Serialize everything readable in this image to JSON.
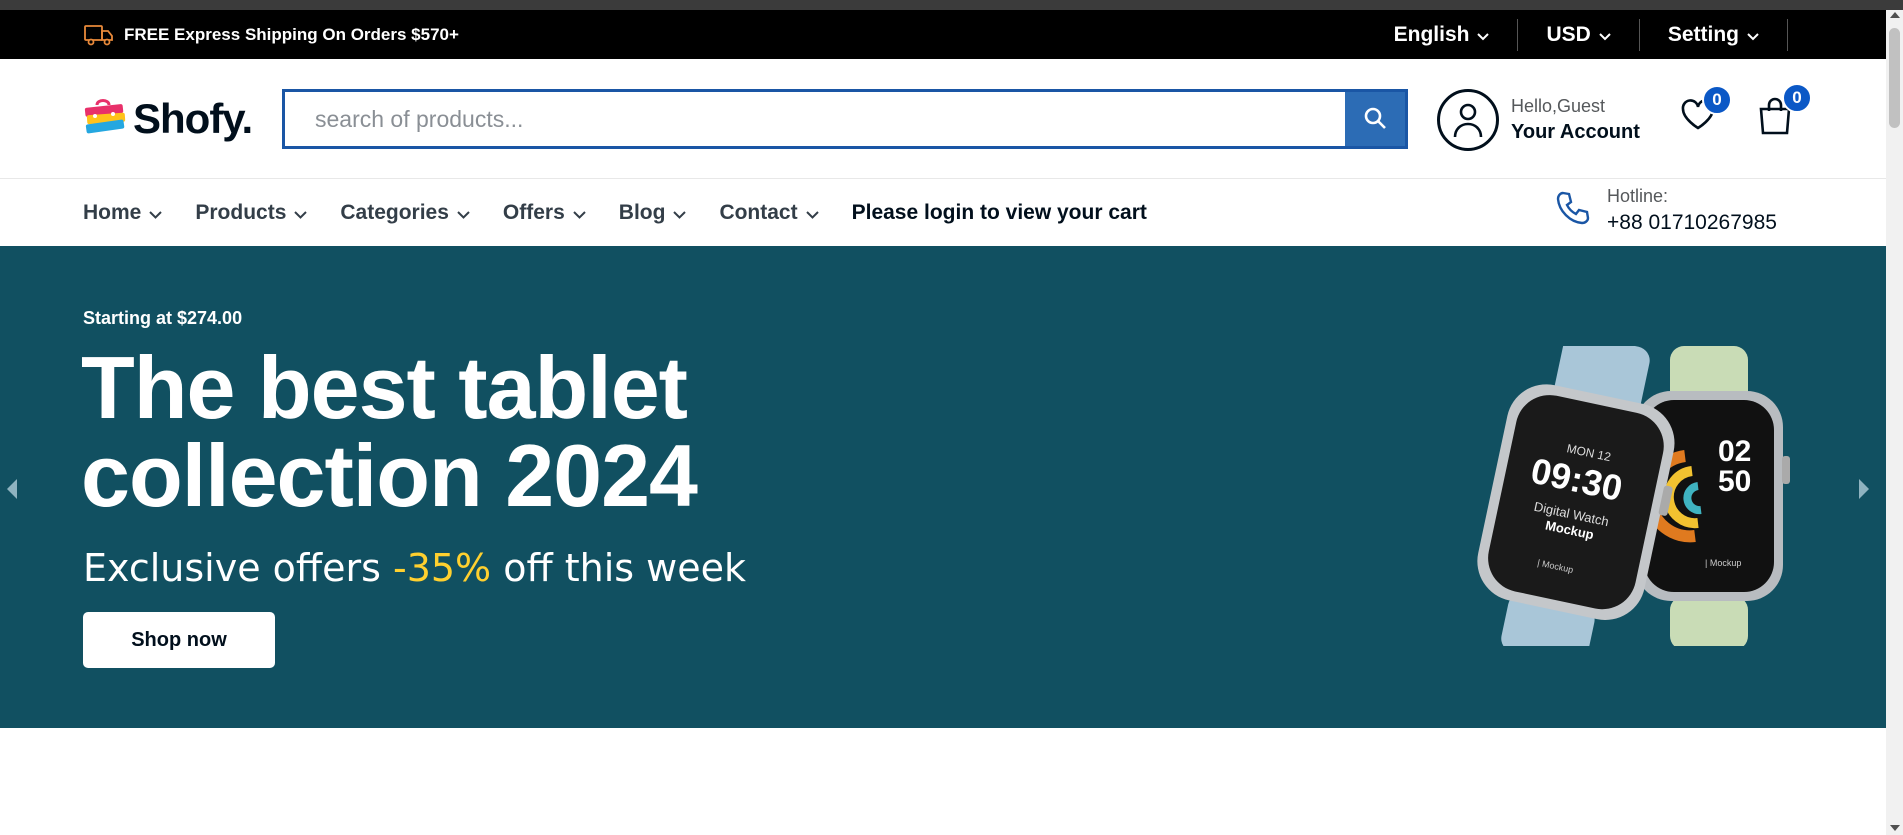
{
  "topbar": {
    "shipping_text": "FREE Express Shipping On Orders $570+",
    "language": "English",
    "currency": "USD",
    "setting": "Setting"
  },
  "header": {
    "logo_text": "Shofy.",
    "search_placeholder": "search of products...",
    "account_greeting": "Hello,Guest",
    "account_title": "Your Account",
    "wishlist_count": "0",
    "cart_count": "0"
  },
  "nav": {
    "items": [
      {
        "label": "Home"
      },
      {
        "label": "Products"
      },
      {
        "label": "Categories"
      },
      {
        "label": "Offers"
      },
      {
        "label": "Blog"
      },
      {
        "label": "Contact"
      }
    ],
    "cart_notice": "Please login to view your cart",
    "hotline_label": "Hotline:",
    "hotline_number": "+88 01710267985"
  },
  "hero": {
    "pre_title": "Starting at $274.00",
    "title_line1": "The best tablet",
    "title_line2": "collection 2024",
    "subtitle_before": "Exclusive offers ",
    "subtitle_highlight": "-35%",
    "subtitle_after": " off this week",
    "button_label": "Shop now",
    "watch1_day": "MON 12",
    "watch1_time": "09:30",
    "watch1_line1": "Digital Watch",
    "watch1_line2": "Mockup",
    "watch1_footer": "| Mockup",
    "watch2_hour": "02",
    "watch2_min": "50",
    "watch2_footer": "| Mockup"
  },
  "colors": {
    "hero_bg": "#115061",
    "accent_blue": "#0b58c6",
    "highlight_yellow": "#ffd02f"
  }
}
